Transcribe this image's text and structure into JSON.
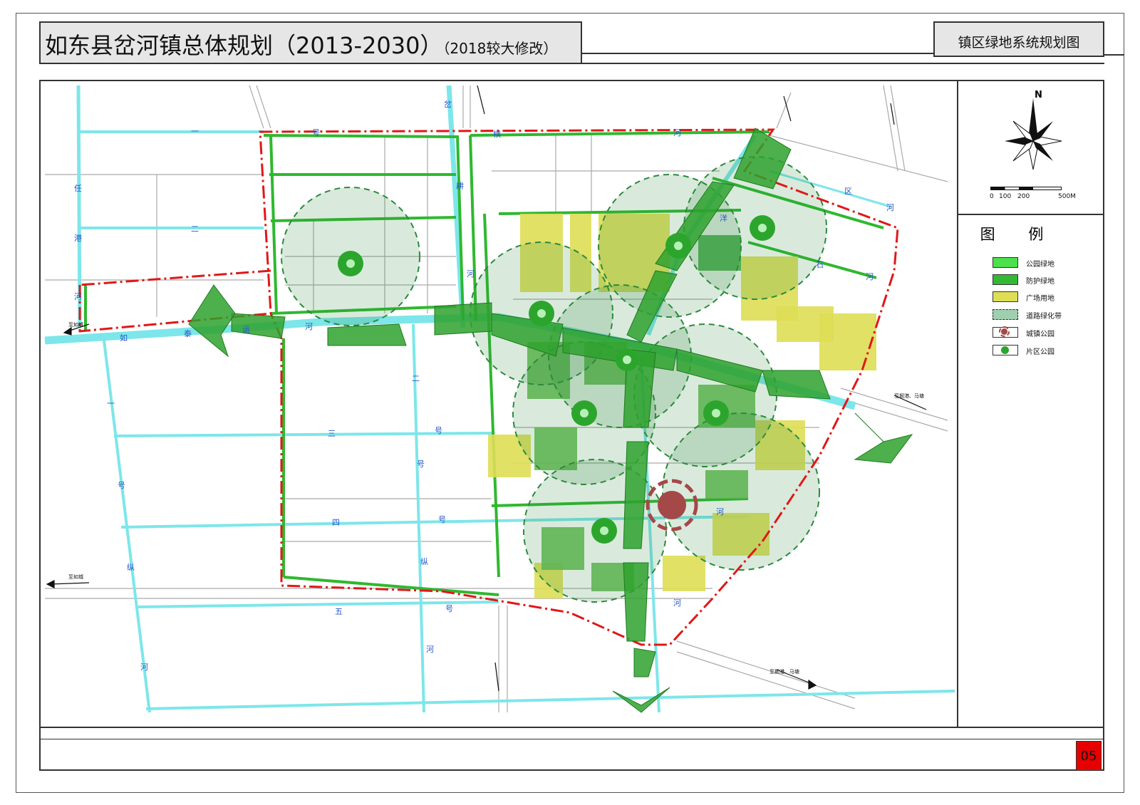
{
  "title": {
    "main": "如东县岔河镇总体规划（2013-2030）",
    "sub": "（2018较大修改）"
  },
  "sheet": {
    "name": "镇区绿地系统规划图",
    "number": "05"
  },
  "compass": {
    "north": "N"
  },
  "scale": {
    "labels": [
      "0",
      "100",
      "200",
      "500M"
    ]
  },
  "legend": {
    "title": "图  例",
    "items": [
      {
        "label": "公园绿地",
        "color": "#4ce04c"
      },
      {
        "label": "防护绿地",
        "color": "#33b833"
      },
      {
        "label": "广场用地",
        "color": "#dede55"
      },
      {
        "label": "道路绿化带",
        "color": "#9fcfae"
      },
      {
        "label": "城镇公园",
        "color": "#a54848"
      },
      {
        "label": "片区公园",
        "color": "#2ca52c"
      }
    ]
  },
  "map_labels": [
    "一",
    "号",
    "河",
    "任",
    "港",
    "河",
    "二",
    "号",
    "河",
    "如",
    "泰",
    "运",
    "河",
    "三",
    "号",
    "四",
    "号",
    "五",
    "号",
    "一",
    "号",
    "纵",
    "河",
    "二",
    "号",
    "纵",
    "河",
    "岔",
    "河",
    "耕",
    "横",
    "河",
    "镇",
    "区",
    "河",
    "石",
    "洋",
    "河",
    "北",
    "石",
    "横",
    "河",
    "民",
    "河",
    "溧",
    "河",
    "至如城",
    "至如城",
    "至岔河口镇",
    "至岔河口镇",
    "至新店",
    "至丰利",
    "至掘港、马塘",
    "至掘港、马塘"
  ]
}
